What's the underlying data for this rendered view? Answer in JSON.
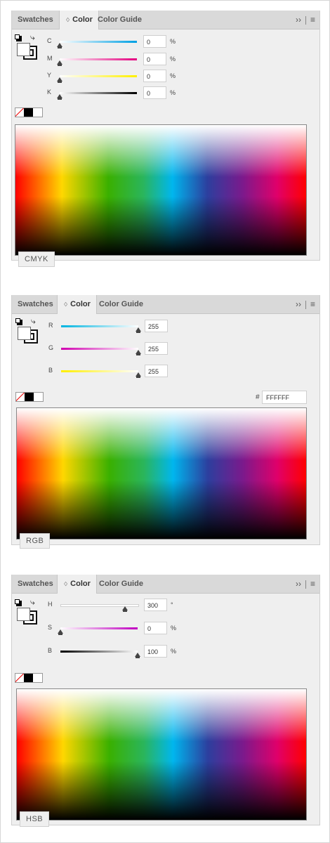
{
  "tabs": {
    "swatches": "Swatches",
    "color": "Color",
    "color_guide": "Color Guide",
    "color_arrows": "♢",
    "expand": "››",
    "menu": "≡"
  },
  "cmyk": {
    "mode_label": "CMYK",
    "sliders": [
      {
        "label": "C",
        "value": "0",
        "unit": "%",
        "level": 0,
        "track": "linear-gradient(to right,#ffffff,#00a0e3)"
      },
      {
        "label": "M",
        "value": "0",
        "unit": "%",
        "level": 0,
        "track": "linear-gradient(to right,#ffffff,#e4007f)"
      },
      {
        "label": "Y",
        "value": "0",
        "unit": "%",
        "level": 0,
        "track": "linear-gradient(to right,#ffffff,#fff000)"
      },
      {
        "label": "K",
        "value": "0",
        "unit": "%",
        "level": 0,
        "track": "linear-gradient(to right,#ffffff,#000000)"
      }
    ]
  },
  "rgb": {
    "mode_label": "RGB",
    "hex_symbol": "#",
    "hex_value": "FFFFFF",
    "sliders": [
      {
        "label": "R",
        "value": "255",
        "unit": "",
        "level": 1,
        "track": "linear-gradient(to right,#00b4e0,#ffffff)"
      },
      {
        "label": "G",
        "value": "255",
        "unit": "",
        "level": 1,
        "track": "linear-gradient(to right,#d100b0,#ffffff)"
      },
      {
        "label": "B",
        "value": "255",
        "unit": "",
        "level": 1,
        "track": "linear-gradient(to right,#ffef00,#ffffff)"
      }
    ]
  },
  "hsb": {
    "mode_label": "HSB",
    "sliders": [
      {
        "label": "H",
        "value": "300",
        "unit": "°",
        "level": 0.8333,
        "track": "linear-gradient(to right,#ffffff,#ffffff)"
      },
      {
        "label": "S",
        "value": "0",
        "unit": "%",
        "level": 0,
        "track": "linear-gradient(to right,#ffffff,#c000c0)"
      },
      {
        "label": "B",
        "value": "100",
        "unit": "%",
        "level": 1,
        "track": "linear-gradient(to right,#000000,#ffffff)"
      }
    ]
  }
}
